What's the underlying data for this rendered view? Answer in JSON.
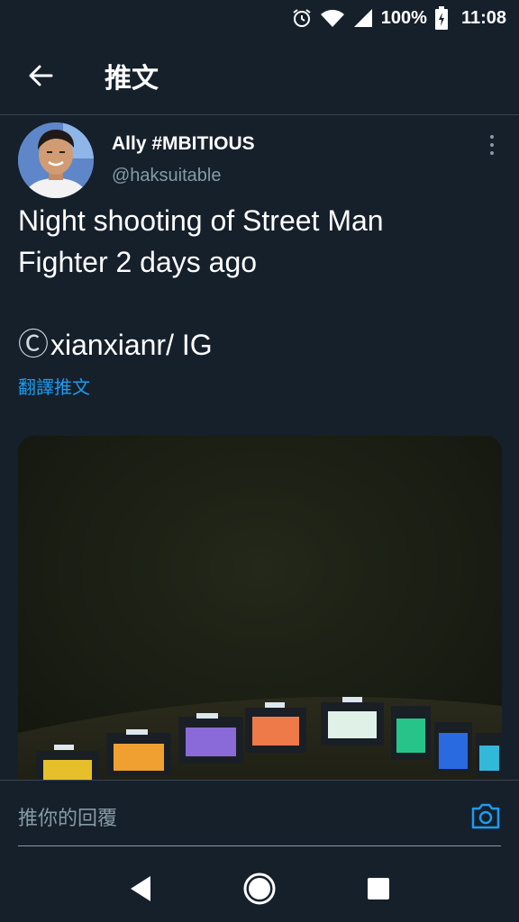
{
  "status_bar": {
    "battery_percent": "100%",
    "time": "11:08"
  },
  "header": {
    "title": "推文"
  },
  "tweet": {
    "display_name": "Ally #MBITIOUS",
    "handle": "@haksuitable",
    "text_line_1": "Night shooting of Street Man",
    "text_line_2": "Fighter 2 days ago",
    "credit_symbol": "Ⓒ",
    "credit_text": "xianxianr/ IG",
    "translate_label": "翻譯推文"
  },
  "reply": {
    "placeholder": "推你的回覆"
  },
  "colors": {
    "background": "#15202b",
    "accent": "#1d9bf0",
    "secondary_text": "#8899a6",
    "divider": "#38444d"
  },
  "icons": {
    "status": [
      "alarm-icon",
      "wifi-icon",
      "signal-icon",
      "battery-icon"
    ],
    "header": [
      "back-arrow-icon"
    ],
    "tweet": [
      "more-options-icon"
    ],
    "reply": [
      "camera-icon"
    ],
    "nav": [
      "nav-back-icon",
      "nav-home-icon",
      "nav-recents-icon"
    ]
  }
}
